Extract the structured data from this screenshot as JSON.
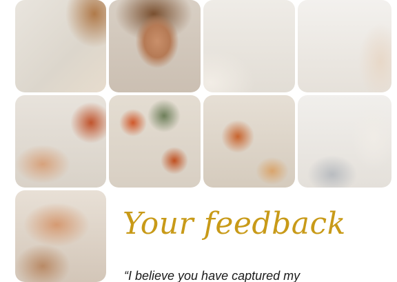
{
  "heading": "Your feedback",
  "quote_fragment": "“I believe you have captured my",
  "colors": {
    "heading": "#c89a18",
    "quote_text": "#1a1a1a",
    "background": "#ffffff"
  },
  "photo": {
    "subject": "smiling-man-patterned-shirt-photo",
    "tile_count": 9
  }
}
